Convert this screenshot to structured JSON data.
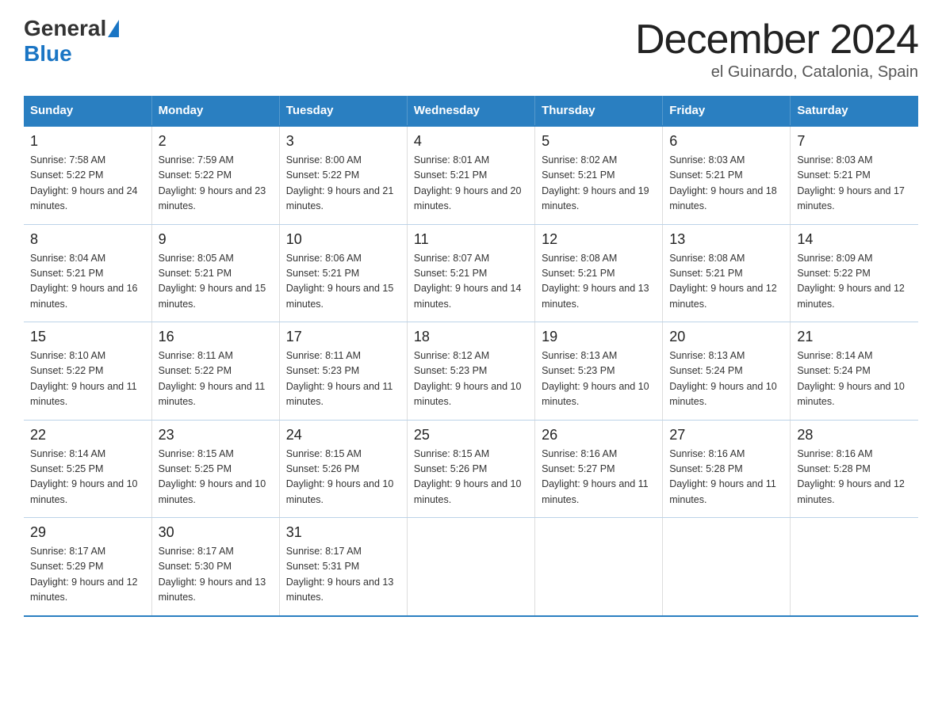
{
  "header": {
    "title": "December 2024",
    "subtitle": "el Guinardo, Catalonia, Spain",
    "logo": {
      "general": "General",
      "blue": "Blue"
    }
  },
  "days_of_week": [
    "Sunday",
    "Monday",
    "Tuesday",
    "Wednesday",
    "Thursday",
    "Friday",
    "Saturday"
  ],
  "weeks": [
    [
      {
        "day": "1",
        "sunrise": "Sunrise: 7:58 AM",
        "sunset": "Sunset: 5:22 PM",
        "daylight": "Daylight: 9 hours and 24 minutes."
      },
      {
        "day": "2",
        "sunrise": "Sunrise: 7:59 AM",
        "sunset": "Sunset: 5:22 PM",
        "daylight": "Daylight: 9 hours and 23 minutes."
      },
      {
        "day": "3",
        "sunrise": "Sunrise: 8:00 AM",
        "sunset": "Sunset: 5:22 PM",
        "daylight": "Daylight: 9 hours and 21 minutes."
      },
      {
        "day": "4",
        "sunrise": "Sunrise: 8:01 AM",
        "sunset": "Sunset: 5:21 PM",
        "daylight": "Daylight: 9 hours and 20 minutes."
      },
      {
        "day": "5",
        "sunrise": "Sunrise: 8:02 AM",
        "sunset": "Sunset: 5:21 PM",
        "daylight": "Daylight: 9 hours and 19 minutes."
      },
      {
        "day": "6",
        "sunrise": "Sunrise: 8:03 AM",
        "sunset": "Sunset: 5:21 PM",
        "daylight": "Daylight: 9 hours and 18 minutes."
      },
      {
        "day": "7",
        "sunrise": "Sunrise: 8:03 AM",
        "sunset": "Sunset: 5:21 PM",
        "daylight": "Daylight: 9 hours and 17 minutes."
      }
    ],
    [
      {
        "day": "8",
        "sunrise": "Sunrise: 8:04 AM",
        "sunset": "Sunset: 5:21 PM",
        "daylight": "Daylight: 9 hours and 16 minutes."
      },
      {
        "day": "9",
        "sunrise": "Sunrise: 8:05 AM",
        "sunset": "Sunset: 5:21 PM",
        "daylight": "Daylight: 9 hours and 15 minutes."
      },
      {
        "day": "10",
        "sunrise": "Sunrise: 8:06 AM",
        "sunset": "Sunset: 5:21 PM",
        "daylight": "Daylight: 9 hours and 15 minutes."
      },
      {
        "day": "11",
        "sunrise": "Sunrise: 8:07 AM",
        "sunset": "Sunset: 5:21 PM",
        "daylight": "Daylight: 9 hours and 14 minutes."
      },
      {
        "day": "12",
        "sunrise": "Sunrise: 8:08 AM",
        "sunset": "Sunset: 5:21 PM",
        "daylight": "Daylight: 9 hours and 13 minutes."
      },
      {
        "day": "13",
        "sunrise": "Sunrise: 8:08 AM",
        "sunset": "Sunset: 5:21 PM",
        "daylight": "Daylight: 9 hours and 12 minutes."
      },
      {
        "day": "14",
        "sunrise": "Sunrise: 8:09 AM",
        "sunset": "Sunset: 5:22 PM",
        "daylight": "Daylight: 9 hours and 12 minutes."
      }
    ],
    [
      {
        "day": "15",
        "sunrise": "Sunrise: 8:10 AM",
        "sunset": "Sunset: 5:22 PM",
        "daylight": "Daylight: 9 hours and 11 minutes."
      },
      {
        "day": "16",
        "sunrise": "Sunrise: 8:11 AM",
        "sunset": "Sunset: 5:22 PM",
        "daylight": "Daylight: 9 hours and 11 minutes."
      },
      {
        "day": "17",
        "sunrise": "Sunrise: 8:11 AM",
        "sunset": "Sunset: 5:23 PM",
        "daylight": "Daylight: 9 hours and 11 minutes."
      },
      {
        "day": "18",
        "sunrise": "Sunrise: 8:12 AM",
        "sunset": "Sunset: 5:23 PM",
        "daylight": "Daylight: 9 hours and 10 minutes."
      },
      {
        "day": "19",
        "sunrise": "Sunrise: 8:13 AM",
        "sunset": "Sunset: 5:23 PM",
        "daylight": "Daylight: 9 hours and 10 minutes."
      },
      {
        "day": "20",
        "sunrise": "Sunrise: 8:13 AM",
        "sunset": "Sunset: 5:24 PM",
        "daylight": "Daylight: 9 hours and 10 minutes."
      },
      {
        "day": "21",
        "sunrise": "Sunrise: 8:14 AM",
        "sunset": "Sunset: 5:24 PM",
        "daylight": "Daylight: 9 hours and 10 minutes."
      }
    ],
    [
      {
        "day": "22",
        "sunrise": "Sunrise: 8:14 AM",
        "sunset": "Sunset: 5:25 PM",
        "daylight": "Daylight: 9 hours and 10 minutes."
      },
      {
        "day": "23",
        "sunrise": "Sunrise: 8:15 AM",
        "sunset": "Sunset: 5:25 PM",
        "daylight": "Daylight: 9 hours and 10 minutes."
      },
      {
        "day": "24",
        "sunrise": "Sunrise: 8:15 AM",
        "sunset": "Sunset: 5:26 PM",
        "daylight": "Daylight: 9 hours and 10 minutes."
      },
      {
        "day": "25",
        "sunrise": "Sunrise: 8:15 AM",
        "sunset": "Sunset: 5:26 PM",
        "daylight": "Daylight: 9 hours and 10 minutes."
      },
      {
        "day": "26",
        "sunrise": "Sunrise: 8:16 AM",
        "sunset": "Sunset: 5:27 PM",
        "daylight": "Daylight: 9 hours and 11 minutes."
      },
      {
        "day": "27",
        "sunrise": "Sunrise: 8:16 AM",
        "sunset": "Sunset: 5:28 PM",
        "daylight": "Daylight: 9 hours and 11 minutes."
      },
      {
        "day": "28",
        "sunrise": "Sunrise: 8:16 AM",
        "sunset": "Sunset: 5:28 PM",
        "daylight": "Daylight: 9 hours and 12 minutes."
      }
    ],
    [
      {
        "day": "29",
        "sunrise": "Sunrise: 8:17 AM",
        "sunset": "Sunset: 5:29 PM",
        "daylight": "Daylight: 9 hours and 12 minutes."
      },
      {
        "day": "30",
        "sunrise": "Sunrise: 8:17 AM",
        "sunset": "Sunset: 5:30 PM",
        "daylight": "Daylight: 9 hours and 13 minutes."
      },
      {
        "day": "31",
        "sunrise": "Sunrise: 8:17 AM",
        "sunset": "Sunset: 5:31 PM",
        "daylight": "Daylight: 9 hours and 13 minutes."
      },
      {
        "day": "",
        "sunrise": "",
        "sunset": "",
        "daylight": ""
      },
      {
        "day": "",
        "sunrise": "",
        "sunset": "",
        "daylight": ""
      },
      {
        "day": "",
        "sunrise": "",
        "sunset": "",
        "daylight": ""
      },
      {
        "day": "",
        "sunrise": "",
        "sunset": "",
        "daylight": ""
      }
    ]
  ]
}
